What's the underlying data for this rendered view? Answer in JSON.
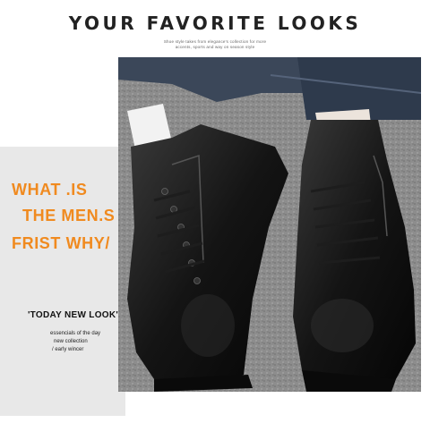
{
  "header": {
    "title": "YOUR FAVORITE LOOKS",
    "subtitle_line1": "Shoe style takes from elegance's collection for more",
    "subtitle_line2": "accents, sports and way on season style"
  },
  "slogan": {
    "line1": "WHAT .IS",
    "line2": "THE MEN.S",
    "line3": "FRIST  WHY/"
  },
  "caption": {
    "headline": "'TODAY NEW LOOK'",
    "line1": "essencials of the day",
    "line2": "new collection",
    "line3": "/ early wincer"
  },
  "colors": {
    "accent": "#f08a1f",
    "panel": "#e8e8e8",
    "text": "#111111"
  }
}
